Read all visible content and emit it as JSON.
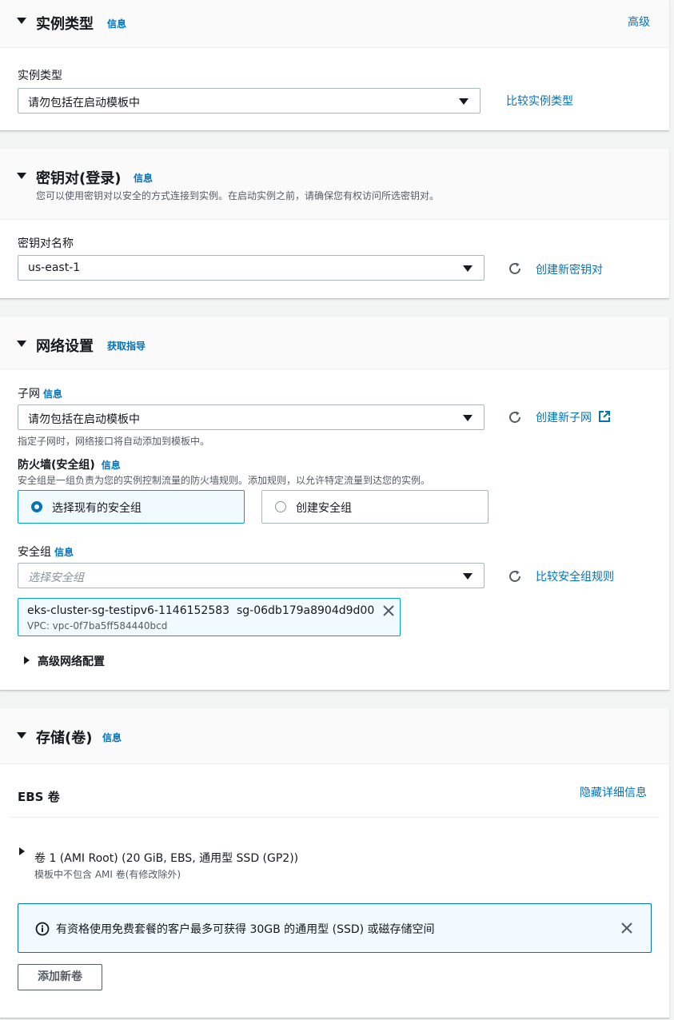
{
  "instance_type": {
    "title": "实例类型",
    "info": "信息",
    "advanced": "高级",
    "field_label": "实例类型",
    "value": "请勿包括在启动模板中",
    "compare_link": "比较实例类型"
  },
  "key_pair": {
    "title": "密钥对(登录)",
    "info": "信息",
    "description": "您可以使用密钥对以安全的方式连接到实例。在启动实例之前，请确保您有权访问所选密钥对。",
    "field_label": "密钥对名称",
    "value": "us-east-1",
    "create_link": "创建新密钥对"
  },
  "network": {
    "title": "网络设置",
    "guide": "获取指导",
    "subnet_label": "子网",
    "subnet_info": "信息",
    "subnet_value": "请勿包括在启动模板中",
    "create_subnet_link": "创建新子网",
    "subnet_hint": "指定子网时，网络接口将自动添加到模板中。",
    "firewall_label": "防火墙(安全组)",
    "firewall_info": "信息",
    "firewall_desc": "安全组是一组负责为您的实例控制流量的防火墙规则。添加规则，以允许特定流量到达您的实例。",
    "option_existing": "选择现有的安全组",
    "option_create": "创建安全组",
    "sg_label": "安全组",
    "sg_info": "信息",
    "sg_placeholder": "选择安全组",
    "compare_sg_link": "比较安全组规则",
    "token_name": "eks-cluster-sg-testipv6-1146152583",
    "token_id": "sg-06db179a8904d9d00",
    "token_vpc": "VPC: vpc-0f7ba5ff584440bcd",
    "advanced": "高级网络配置"
  },
  "storage": {
    "title": "存储(卷)",
    "info": "信息",
    "ebs_title": "EBS 卷",
    "hide_details": "隐藏详细信息",
    "volume_title": "卷 1 (AMI Root) (20 GiB, EBS, 通用型 SSD (GP2))",
    "volume_desc": "模板中不包含 AMI 卷(有修改除外)",
    "alert_text": "有资格使用免费套餐的客户最多可获得 30GB 的通用型 (SSD) 或磁存储空间",
    "add_volume": "添加新卷"
  },
  "colors": {
    "link": "#0073bb",
    "text": "#16191f",
    "border": "#aab7b8",
    "selected_bg": "#f1faff",
    "page_bg": "#f2f3f3"
  }
}
